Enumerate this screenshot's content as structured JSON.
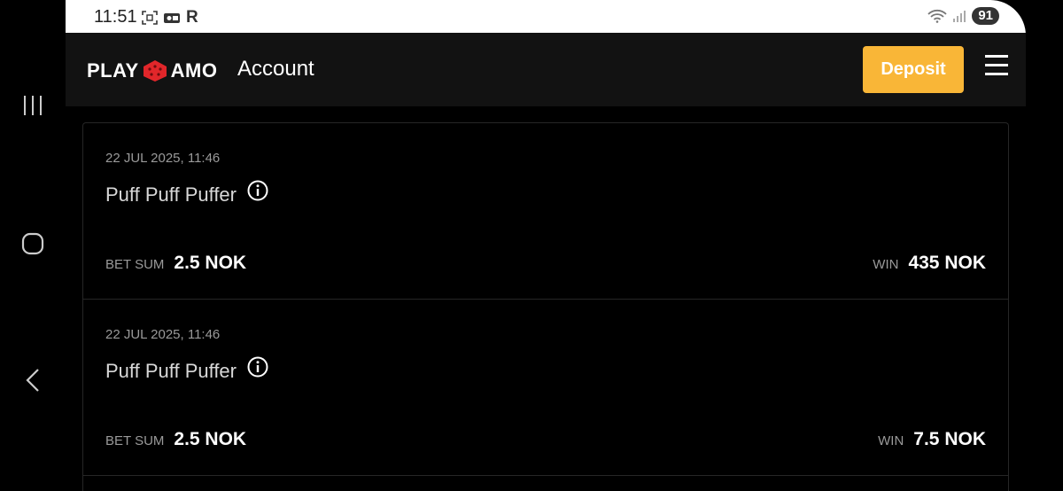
{
  "status_bar": {
    "time": "11:51",
    "carrier_icon": "R",
    "battery": "91"
  },
  "header": {
    "logo_left": "PLAY",
    "logo_right": "AMO",
    "title": "Account",
    "deposit_label": "Deposit"
  },
  "history": [
    {
      "date": "22 JUL 2025, 11:46",
      "game": "Puff Puff Puffer",
      "bet_label": "BET SUM",
      "bet_value": "2.5 NOK",
      "win_label": "WIN",
      "win_value": "435 NOK"
    },
    {
      "date": "22 JUL 2025, 11:46",
      "game": "Puff Puff Puffer",
      "bet_label": "BET SUM",
      "bet_value": "2.5 NOK",
      "win_label": "WIN",
      "win_value": "7.5 NOK"
    }
  ],
  "colors": {
    "accent": "#f9b637",
    "header_bg": "#121212",
    "logo_red": "#e1262a"
  }
}
